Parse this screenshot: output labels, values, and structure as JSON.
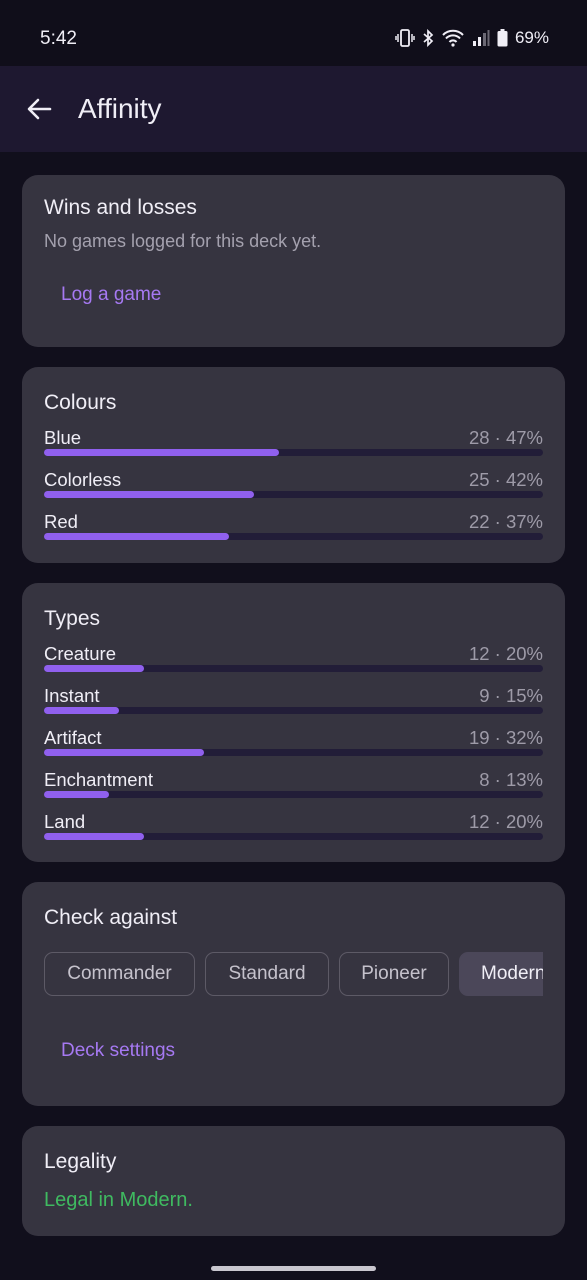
{
  "status_bar": {
    "time": "5:42",
    "battery": "69%",
    "icons": [
      "vibrate-icon",
      "bluetooth-icon",
      "wifi-icon",
      "signal-icon",
      "battery-icon"
    ]
  },
  "app_bar": {
    "title": "Affinity",
    "back_icon": "arrow-left-icon"
  },
  "wins": {
    "title": "Wins and losses",
    "subtitle": "No games logged for this deck yet.",
    "log_button": "Log a game"
  },
  "colours": {
    "title": "Colours",
    "items": [
      {
        "label": "Blue",
        "value": "28 · 47%",
        "fraction": 0.47
      },
      {
        "label": "Colorless",
        "value": "25 · 42%",
        "fraction": 0.42
      },
      {
        "label": "Red",
        "value": "22 · 37%",
        "fraction": 0.37
      }
    ]
  },
  "types": {
    "title": "Types",
    "items": [
      {
        "label": "Creature",
        "value": "12 · 20%",
        "fraction": 0.2
      },
      {
        "label": "Instant",
        "value": "9 · 15%",
        "fraction": 0.15
      },
      {
        "label": "Artifact",
        "value": "19 · 32%",
        "fraction": 0.32
      },
      {
        "label": "Enchantment",
        "value": "8 · 13%",
        "fraction": 0.13
      },
      {
        "label": "Land",
        "value": "12 · 20%",
        "fraction": 0.2
      }
    ]
  },
  "check": {
    "title": "Check against",
    "formats": [
      "Commander",
      "Standard",
      "Pioneer",
      "Modern"
    ],
    "selected": "Modern",
    "settings_button": "Deck settings"
  },
  "legality": {
    "title": "Legality",
    "status": "Legal in Modern."
  },
  "colors": {
    "accent": "#a679f2",
    "bar_fill": "#9060ee",
    "legal_green": "#3fba60"
  }
}
